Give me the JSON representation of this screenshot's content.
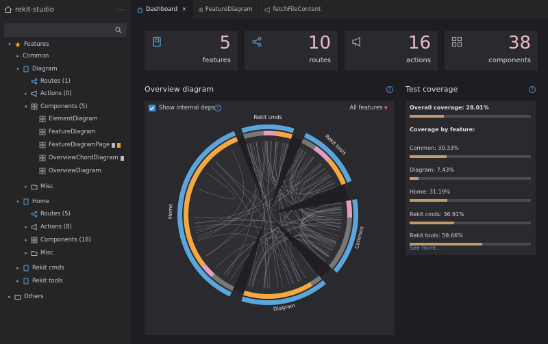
{
  "app": {
    "title": "rekit-studio",
    "menu_dots": "···"
  },
  "search": {
    "placeholder": ""
  },
  "tree": [
    {
      "label": "Features",
      "icon": "features-icon",
      "twisty": "▾",
      "expanded": true
    },
    {
      "label": "Common",
      "icon": "",
      "twisty": "▸"
    },
    {
      "label": "Diagram",
      "icon": "feature-icon",
      "twisty": "▾"
    },
    {
      "label": "Routes (1)",
      "icon": "routes-icon",
      "twisty": ""
    },
    {
      "label": "Actions (0)",
      "icon": "actions-icon",
      "twisty": "▸"
    },
    {
      "label": "Components (5)",
      "icon": "components-icon",
      "twisty": "▾"
    },
    {
      "label": "ElementDiagram",
      "icon": "component-icon",
      "twisty": ""
    },
    {
      "label": "FeatureDiagram",
      "icon": "component-icon",
      "twisty": ""
    },
    {
      "label": "FeatureDiagramPage",
      "icon": "component-icon",
      "twisty": ""
    },
    {
      "label": "OverviewChordDiagram",
      "icon": "component-icon",
      "twisty": ""
    },
    {
      "label": "OverviewDiagram",
      "icon": "component-icon",
      "twisty": ""
    },
    {
      "label": "Misc",
      "icon": "folder-icon",
      "twisty": "▸"
    },
    {
      "label": "Home",
      "icon": "feature-icon",
      "twisty": "▾"
    },
    {
      "label": "Routes (5)",
      "icon": "routes-icon",
      "twisty": ""
    },
    {
      "label": "Actions (8)",
      "icon": "actions-icon",
      "twisty": "▸"
    },
    {
      "label": "Components (18)",
      "icon": "components-icon",
      "twisty": "▸"
    },
    {
      "label": "Misc",
      "icon": "folder-icon",
      "twisty": "▸"
    },
    {
      "label": "Rekit cmds",
      "icon": "feature-icon",
      "twisty": "▸"
    },
    {
      "label": "Rekit tools",
      "icon": "feature-icon",
      "twisty": "▸"
    },
    {
      "label": "Others",
      "icon": "folder-icon",
      "twisty": "▸"
    }
  ],
  "tabs": [
    {
      "label": "Dashboard",
      "active": true,
      "close": "×"
    },
    {
      "label": "FeatureDiagram",
      "active": false
    },
    {
      "label": "fetchFileContent",
      "active": false
    }
  ],
  "stats": [
    {
      "value": "5",
      "label": "features",
      "icon": "book-icon"
    },
    {
      "value": "10",
      "label": "routes",
      "icon": "share-icon"
    },
    {
      "value": "16",
      "label": "actions",
      "icon": "megaphone-icon"
    },
    {
      "value": "38",
      "label": "components",
      "icon": "grid-icon"
    }
  ],
  "overview": {
    "title": "Overview diagram",
    "show_internal_label": "Show internal deps",
    "filter": "All features",
    "segments": [
      "Rekit cmds",
      "Rekit tools",
      "Common",
      "Diagram",
      "Home"
    ]
  },
  "coverage": {
    "title": "Test coverage",
    "overall": "Overall coverage: 28.01%",
    "overall_pct": 28.01,
    "by_feature": "Coverage by feature:",
    "items": [
      {
        "label": "Common: 30.33%",
        "pct": 30.33
      },
      {
        "label": "Diagram: 7.43%",
        "pct": 7.43
      },
      {
        "label": "Home: 31.19%",
        "pct": 31.19
      },
      {
        "label": "Rekit cmds: 36.91%",
        "pct": 36.91
      },
      {
        "label": "Rekit tools: 59.66%",
        "pct": 59.66
      }
    ],
    "see_more": "See more..."
  },
  "colors": {
    "accent": "#3a8ad6",
    "number": "#ecb9c6",
    "orange": "#f5a742",
    "pink": "#e49ec2",
    "blue": "#5aa6dc",
    "bar_fill": "#c39a6b"
  }
}
